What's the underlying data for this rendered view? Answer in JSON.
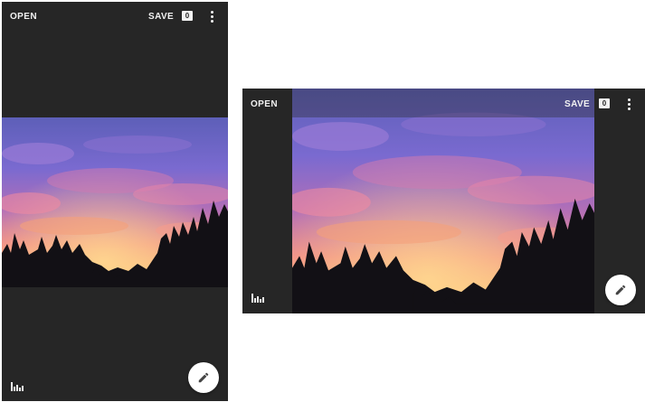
{
  "portrait": {
    "open_label": "OPEN",
    "save_label": "SAVE",
    "badge_count": "0",
    "menu_icon": "more-vert-icon",
    "histogram_icon": "histogram-icon",
    "edit_icon": "pencil-icon"
  },
  "landscape": {
    "open_label": "OPEN",
    "save_label": "SAVE",
    "badge_count": "0",
    "menu_icon": "more-vert-icon",
    "histogram_icon": "histogram-icon",
    "edit_icon": "pencil-icon"
  },
  "colors": {
    "app_background": "#262626",
    "text": "#f2f2f2",
    "fab_background": "#ffffff"
  }
}
